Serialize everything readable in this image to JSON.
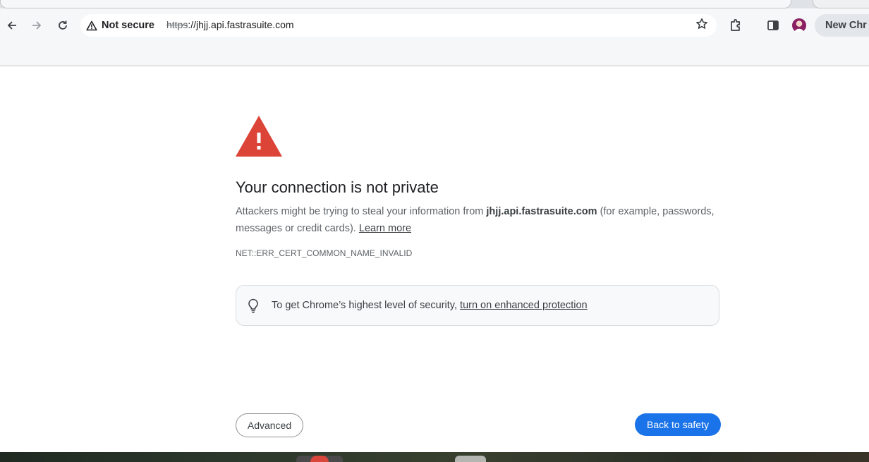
{
  "browser": {
    "security_label": "Not secure",
    "url_scheme": "https",
    "url_rest": "://jhjj.api.fastrasuite.com",
    "new_chrome_label": "New Chr"
  },
  "interstitial": {
    "heading": "Your connection is not private",
    "explanation_prefix": "Attackers might be trying to steal your information from ",
    "host": "jhjj.api.fastrasuite.com",
    "explanation_suffix": " (for example, passwords, messages or credit cards). ",
    "learn_more": "Learn more",
    "error_code": "NET::ERR_CERT_COMMON_NAME_INVALID",
    "enhanced_prefix": "To get Chrome’s highest level of security, ",
    "enhanced_link": "turn on enhanced protection",
    "advanced_label": "Advanced",
    "back_label": "Back to safety"
  },
  "colors": {
    "warning_red": "#db4437",
    "primary_blue": "#1a73e8"
  },
  "icons": [
    "back-arrow-icon",
    "forward-arrow-icon",
    "reload-icon",
    "warning-triangle-icon",
    "star-icon",
    "extensions-icon",
    "side-panel-icon",
    "lightbulb-icon"
  ]
}
